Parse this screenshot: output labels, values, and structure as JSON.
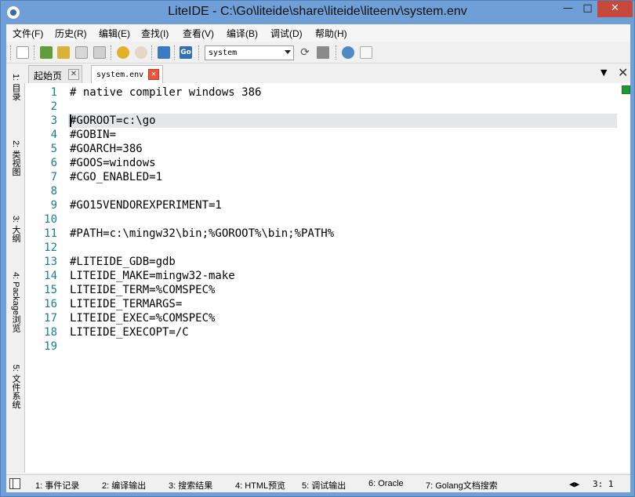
{
  "window": {
    "title": "LiteIDE - C:\\Go\\liteide\\share\\liteide\\liteenv\\system.env",
    "minimize": "—",
    "maximize": "□",
    "close": "✕"
  },
  "menu": [
    "文件(F)",
    "历史(R)",
    "编辑(E)",
    "查找(I)",
    "查看(V)",
    "编译(B)",
    "调试(D)",
    "帮助(H)"
  ],
  "toolbar": {
    "env_combo": "system",
    "go_label": "Go"
  },
  "tabs": [
    {
      "label": "起始页",
      "close": "✕"
    },
    {
      "label": "system.env",
      "close": "✕"
    }
  ],
  "tab_actions": {
    "menu": "▼",
    "close": "✕"
  },
  "sidebar": [
    "1: 目录",
    "2: 类视图",
    "3: 大纲",
    "4: Package浏览",
    "5: 文件系统"
  ],
  "editor": {
    "line_numbers": [
      "1",
      "2",
      "3",
      "4",
      "5",
      "6",
      "7",
      "8",
      "9",
      "10",
      "11",
      "12",
      "13",
      "14",
      "15",
      "16",
      "17",
      "18",
      "19"
    ],
    "lines": [
      "# native compiler windows 386",
      "",
      "#GOROOT=c:\\go",
      "#GOBIN=",
      "#GOARCH=386",
      "#GOOS=windows",
      "#CGO_ENABLED=1",
      "",
      "#GO15VENDOREXPERIMENT=1",
      "",
      "#PATH=c:\\mingw32\\bin;%GOROOT%\\bin;%PATH%",
      "",
      "#LITEIDE_GDB=gdb",
      "LITEIDE_MAKE=mingw32-make",
      "LITEIDE_TERM=%COMSPEC%",
      "LITEIDE_TERMARGS=",
      "LITEIDE_EXEC=%COMSPEC%",
      "LITEIDE_EXECOPT=/C",
      ""
    ],
    "current_line": 3
  },
  "bottom_tabs": [
    "1: 事件记录",
    "2: 编译输出",
    "3: 搜索结果",
    "4: HTML预览",
    "5: 调试输出",
    "6: Oracle",
    "7: Golang文档搜索"
  ],
  "status": {
    "arrows": "◀▶",
    "position": "3:  1"
  },
  "colors": {
    "titlebar": "#6f9fd6",
    "line_number": "#1a7ba0",
    "current_line": "#e4e7ea",
    "close_button": "#c7493c",
    "tab_close_active": "#e9553b"
  }
}
